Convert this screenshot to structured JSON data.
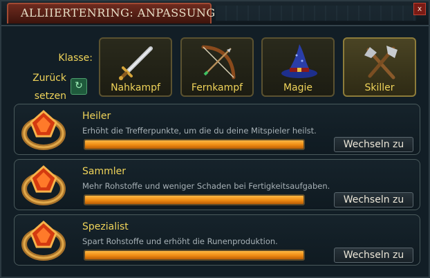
{
  "window": {
    "title": "ALLIIERTENRING: ANPASSUNG",
    "close_label": "x"
  },
  "class_section": {
    "klasse_label": "Klasse:",
    "reset_label_1": "Zurück",
    "reset_label_2": "setzen",
    "buttons": [
      {
        "label": "Nahkampf",
        "icon": "sword-icon"
      },
      {
        "label": "Fernkampf",
        "icon": "bow-icon"
      },
      {
        "label": "Magie",
        "icon": "wizard-hat-icon"
      },
      {
        "label": "Skiller",
        "icon": "hatchet-icon",
        "selected": true
      }
    ]
  },
  "cards": [
    {
      "name": "Heiler",
      "description": "Erhöht die Trefferpunkte, um die du deine Mitspieler heilst.",
      "progress": 1.0,
      "button": "Wechseln zu"
    },
    {
      "name": "Sammler",
      "description": "Mehr Rohstoffe und weniger Schaden bei Fertigkeitsaufgaben.",
      "progress": 1.0,
      "button": "Wechseln zu"
    },
    {
      "name": "Spezialist",
      "description": "Spart Rohstoffe und erhöht die Runenproduktion.",
      "progress": 1.0,
      "button": "Wechseln zu"
    }
  ],
  "colors": {
    "accent": "#f0d45a",
    "bar": "#ee8a12",
    "title_tab": "#6e2b1f"
  }
}
